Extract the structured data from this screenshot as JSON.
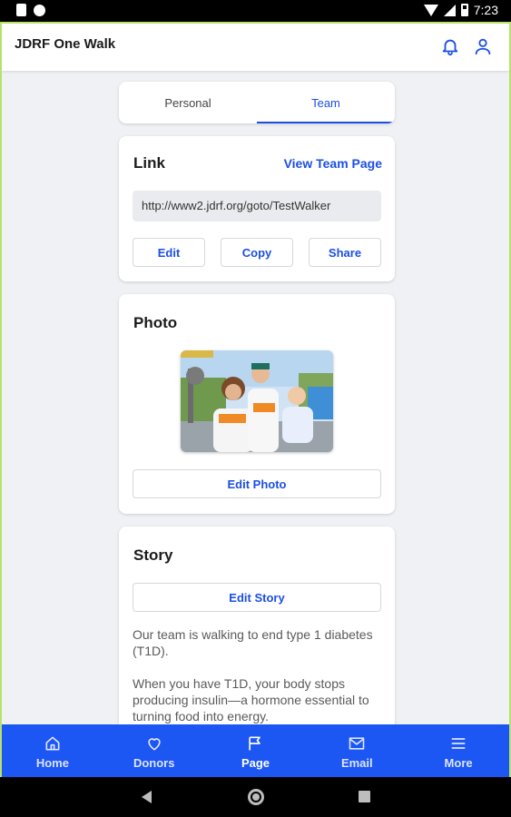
{
  "status_bar": {
    "time": "7:23"
  },
  "header": {
    "title": "JDRF One Walk"
  },
  "tabs": [
    {
      "label": "Personal",
      "active": false
    },
    {
      "label": "Team",
      "active": true
    }
  ],
  "link_card": {
    "title": "Link",
    "view_link": "View Team Page",
    "url": "http://www2.jdrf.org/goto/TestWalker",
    "edit_label": "Edit",
    "copy_label": "Copy",
    "share_label": "Share"
  },
  "photo_card": {
    "title": "Photo",
    "edit_label": "Edit Photo"
  },
  "story_card": {
    "title": "Story",
    "edit_label": "Edit Story",
    "paragraphs": [
      "Our team is walking to end type 1 diabetes (T1D).",
      "When you have T1D, your body stops producing insulin—a hormone essential to turning food into energy."
    ]
  },
  "bottom_nav": [
    {
      "label": "Home",
      "icon": "home-icon"
    },
    {
      "label": "Donors",
      "icon": "heart-icon"
    },
    {
      "label": "Page",
      "icon": "flag-icon",
      "active": true
    },
    {
      "label": "Email",
      "icon": "mail-icon"
    },
    {
      "label": "More",
      "icon": "menu-icon"
    }
  ],
  "colors": {
    "accent": "#1c56f3",
    "link": "#1b4fe3"
  }
}
